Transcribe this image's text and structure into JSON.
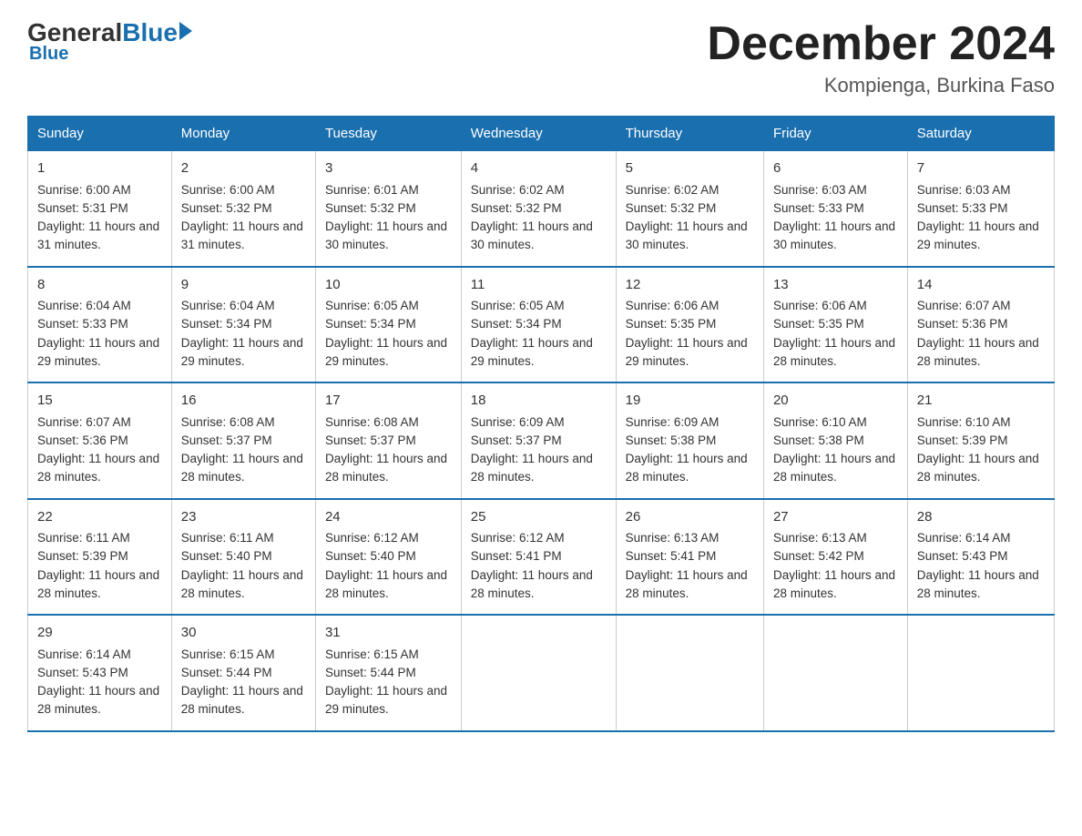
{
  "logo": {
    "general": "General",
    "blue": "Blue",
    "subtitle": "Blue"
  },
  "header": {
    "title": "December 2024",
    "location": "Kompienga, Burkina Faso"
  },
  "days_of_week": [
    "Sunday",
    "Monday",
    "Tuesday",
    "Wednesday",
    "Thursday",
    "Friday",
    "Saturday"
  ],
  "weeks": [
    [
      {
        "day": "1",
        "sunrise": "6:00 AM",
        "sunset": "5:31 PM",
        "daylight": "11 hours and 31 minutes."
      },
      {
        "day": "2",
        "sunrise": "6:00 AM",
        "sunset": "5:32 PM",
        "daylight": "11 hours and 31 minutes."
      },
      {
        "day": "3",
        "sunrise": "6:01 AM",
        "sunset": "5:32 PM",
        "daylight": "11 hours and 30 minutes."
      },
      {
        "day": "4",
        "sunrise": "6:02 AM",
        "sunset": "5:32 PM",
        "daylight": "11 hours and 30 minutes."
      },
      {
        "day": "5",
        "sunrise": "6:02 AM",
        "sunset": "5:32 PM",
        "daylight": "11 hours and 30 minutes."
      },
      {
        "day": "6",
        "sunrise": "6:03 AM",
        "sunset": "5:33 PM",
        "daylight": "11 hours and 30 minutes."
      },
      {
        "day": "7",
        "sunrise": "6:03 AM",
        "sunset": "5:33 PM",
        "daylight": "11 hours and 29 minutes."
      }
    ],
    [
      {
        "day": "8",
        "sunrise": "6:04 AM",
        "sunset": "5:33 PM",
        "daylight": "11 hours and 29 minutes."
      },
      {
        "day": "9",
        "sunrise": "6:04 AM",
        "sunset": "5:34 PM",
        "daylight": "11 hours and 29 minutes."
      },
      {
        "day": "10",
        "sunrise": "6:05 AM",
        "sunset": "5:34 PM",
        "daylight": "11 hours and 29 minutes."
      },
      {
        "day": "11",
        "sunrise": "6:05 AM",
        "sunset": "5:34 PM",
        "daylight": "11 hours and 29 minutes."
      },
      {
        "day": "12",
        "sunrise": "6:06 AM",
        "sunset": "5:35 PM",
        "daylight": "11 hours and 29 minutes."
      },
      {
        "day": "13",
        "sunrise": "6:06 AM",
        "sunset": "5:35 PM",
        "daylight": "11 hours and 28 minutes."
      },
      {
        "day": "14",
        "sunrise": "6:07 AM",
        "sunset": "5:36 PM",
        "daylight": "11 hours and 28 minutes."
      }
    ],
    [
      {
        "day": "15",
        "sunrise": "6:07 AM",
        "sunset": "5:36 PM",
        "daylight": "11 hours and 28 minutes."
      },
      {
        "day": "16",
        "sunrise": "6:08 AM",
        "sunset": "5:37 PM",
        "daylight": "11 hours and 28 minutes."
      },
      {
        "day": "17",
        "sunrise": "6:08 AM",
        "sunset": "5:37 PM",
        "daylight": "11 hours and 28 minutes."
      },
      {
        "day": "18",
        "sunrise": "6:09 AM",
        "sunset": "5:37 PM",
        "daylight": "11 hours and 28 minutes."
      },
      {
        "day": "19",
        "sunrise": "6:09 AM",
        "sunset": "5:38 PM",
        "daylight": "11 hours and 28 minutes."
      },
      {
        "day": "20",
        "sunrise": "6:10 AM",
        "sunset": "5:38 PM",
        "daylight": "11 hours and 28 minutes."
      },
      {
        "day": "21",
        "sunrise": "6:10 AM",
        "sunset": "5:39 PM",
        "daylight": "11 hours and 28 minutes."
      }
    ],
    [
      {
        "day": "22",
        "sunrise": "6:11 AM",
        "sunset": "5:39 PM",
        "daylight": "11 hours and 28 minutes."
      },
      {
        "day": "23",
        "sunrise": "6:11 AM",
        "sunset": "5:40 PM",
        "daylight": "11 hours and 28 minutes."
      },
      {
        "day": "24",
        "sunrise": "6:12 AM",
        "sunset": "5:40 PM",
        "daylight": "11 hours and 28 minutes."
      },
      {
        "day": "25",
        "sunrise": "6:12 AM",
        "sunset": "5:41 PM",
        "daylight": "11 hours and 28 minutes."
      },
      {
        "day": "26",
        "sunrise": "6:13 AM",
        "sunset": "5:41 PM",
        "daylight": "11 hours and 28 minutes."
      },
      {
        "day": "27",
        "sunrise": "6:13 AM",
        "sunset": "5:42 PM",
        "daylight": "11 hours and 28 minutes."
      },
      {
        "day": "28",
        "sunrise": "6:14 AM",
        "sunset": "5:43 PM",
        "daylight": "11 hours and 28 minutes."
      }
    ],
    [
      {
        "day": "29",
        "sunrise": "6:14 AM",
        "sunset": "5:43 PM",
        "daylight": "11 hours and 28 minutes."
      },
      {
        "day": "30",
        "sunrise": "6:15 AM",
        "sunset": "5:44 PM",
        "daylight": "11 hours and 28 minutes."
      },
      {
        "day": "31",
        "sunrise": "6:15 AM",
        "sunset": "5:44 PM",
        "daylight": "11 hours and 29 minutes."
      },
      null,
      null,
      null,
      null
    ]
  ],
  "labels": {
    "sunrise": "Sunrise:",
    "sunset": "Sunset:",
    "daylight": "Daylight:"
  }
}
